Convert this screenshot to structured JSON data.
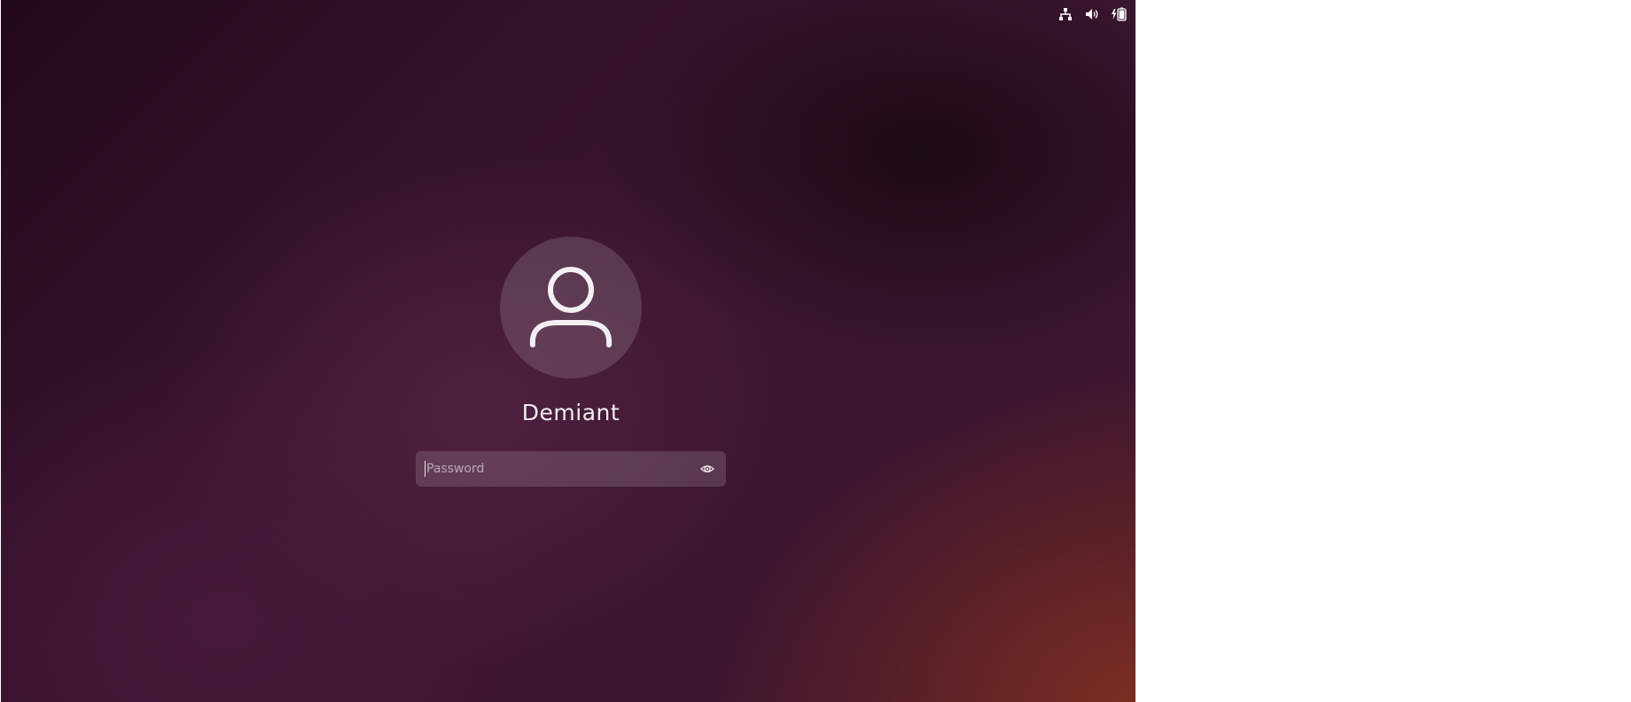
{
  "top_bar": {
    "icons": [
      "network-wired-icon",
      "volume-icon",
      "battery-charging-icon"
    ]
  },
  "login": {
    "avatar_icon": "user-avatar-icon",
    "username": "Demiant",
    "password_field": {
      "placeholder": "Password",
      "value": ""
    },
    "reveal_icon": "eye-reveal-icon"
  },
  "colors": {
    "background_dark": "#22091a",
    "background_accent": "#7a2e22",
    "foreground": "#f2eef0"
  }
}
